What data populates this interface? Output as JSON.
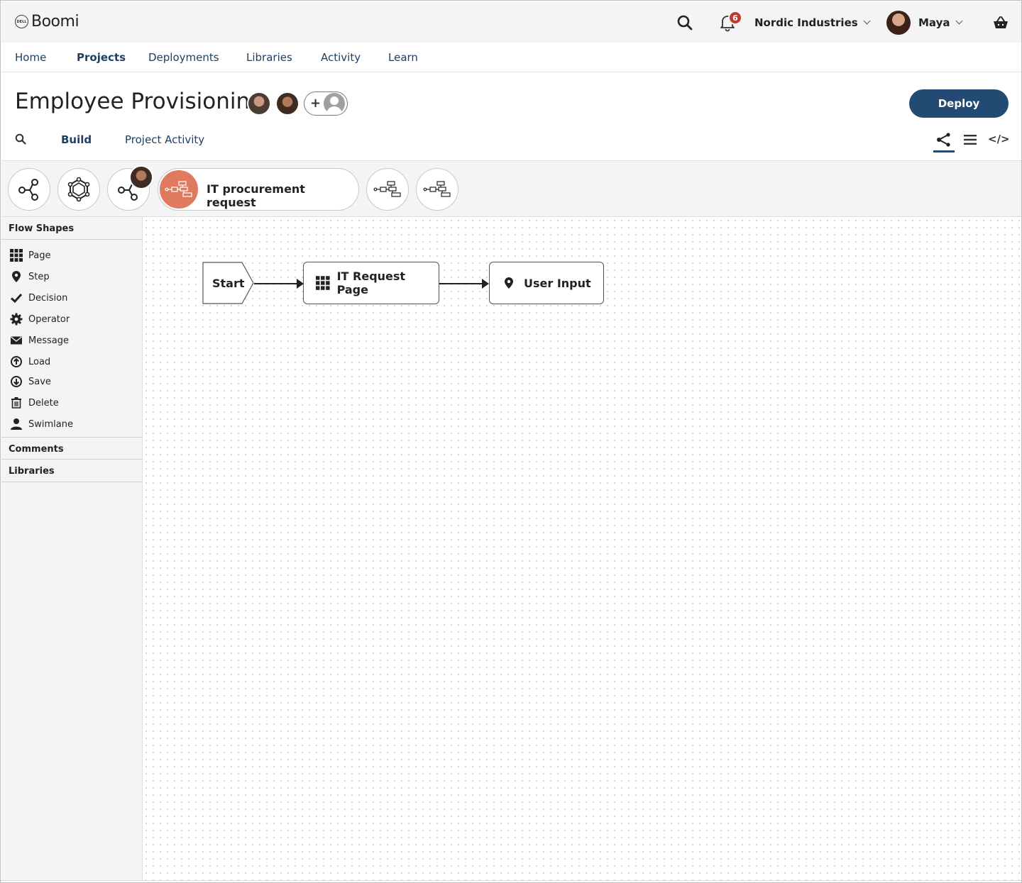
{
  "app": {
    "brand": "Boomi",
    "dell_mark": "DELL"
  },
  "header": {
    "notifications_count": "6",
    "org_name": "Nordic Industries",
    "user_name": "Maya"
  },
  "nav": [
    "Home",
    "Projects",
    "Deployments",
    "Libraries",
    "Activity",
    "Learn"
  ],
  "nav_active": "Projects",
  "project": {
    "title": "Employee Provisioning",
    "add_collaborator": "+",
    "deploy_label": "Deploy",
    "tabs": [
      "Build",
      "Project Activity"
    ],
    "active_tab": "Build",
    "view_code_label": "</>"
  },
  "flow_tabs": {
    "active_label": "IT procurement request"
  },
  "sidebar": {
    "flow_shapes_title": "Flow Shapes",
    "shapes": [
      "Page",
      "Step",
      "Decision",
      "Operator",
      "Message",
      "Load",
      "Save",
      "Delete",
      "Swimlane"
    ],
    "comments_title": "Comments",
    "libraries_title": "Libraries"
  },
  "canvas": {
    "nodes": [
      "Start",
      "IT Request Page",
      "User Input"
    ]
  },
  "colors": {
    "accent": "#234a73",
    "flow_active": "#e07a5f",
    "badge": "#c0392b"
  }
}
